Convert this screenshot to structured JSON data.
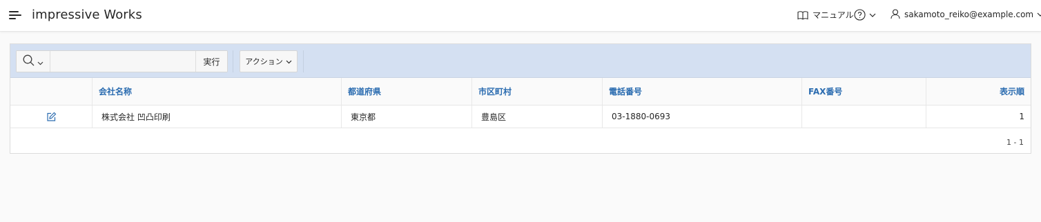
{
  "header": {
    "app_title": "impressive Works",
    "manual_label": "マニュアル",
    "user_label": "sakamoto_reiko@example.com"
  },
  "toolbar": {
    "search_placeholder": "",
    "go_label": "実行",
    "actions_label": "アクション"
  },
  "table": {
    "columns": [
      "会社名称",
      "都道府県",
      "市区町村",
      "電話番号",
      "FAX番号",
      "表示順"
    ],
    "rows": [
      {
        "company": "株式会社 凹凸印刷",
        "prefecture": "東京都",
        "city": "豊島区",
        "phone": "03-1880-0693",
        "fax": "",
        "order": "1"
      }
    ]
  },
  "pagination": "1 - 1",
  "colors": {
    "accent": "#2b6cb0",
    "toolbar_bg": "#d4e0f2"
  },
  "icons": [
    "menu-icon",
    "book-icon",
    "help-icon",
    "user-icon",
    "chevron-down-icon",
    "search-icon",
    "edit-icon"
  ]
}
